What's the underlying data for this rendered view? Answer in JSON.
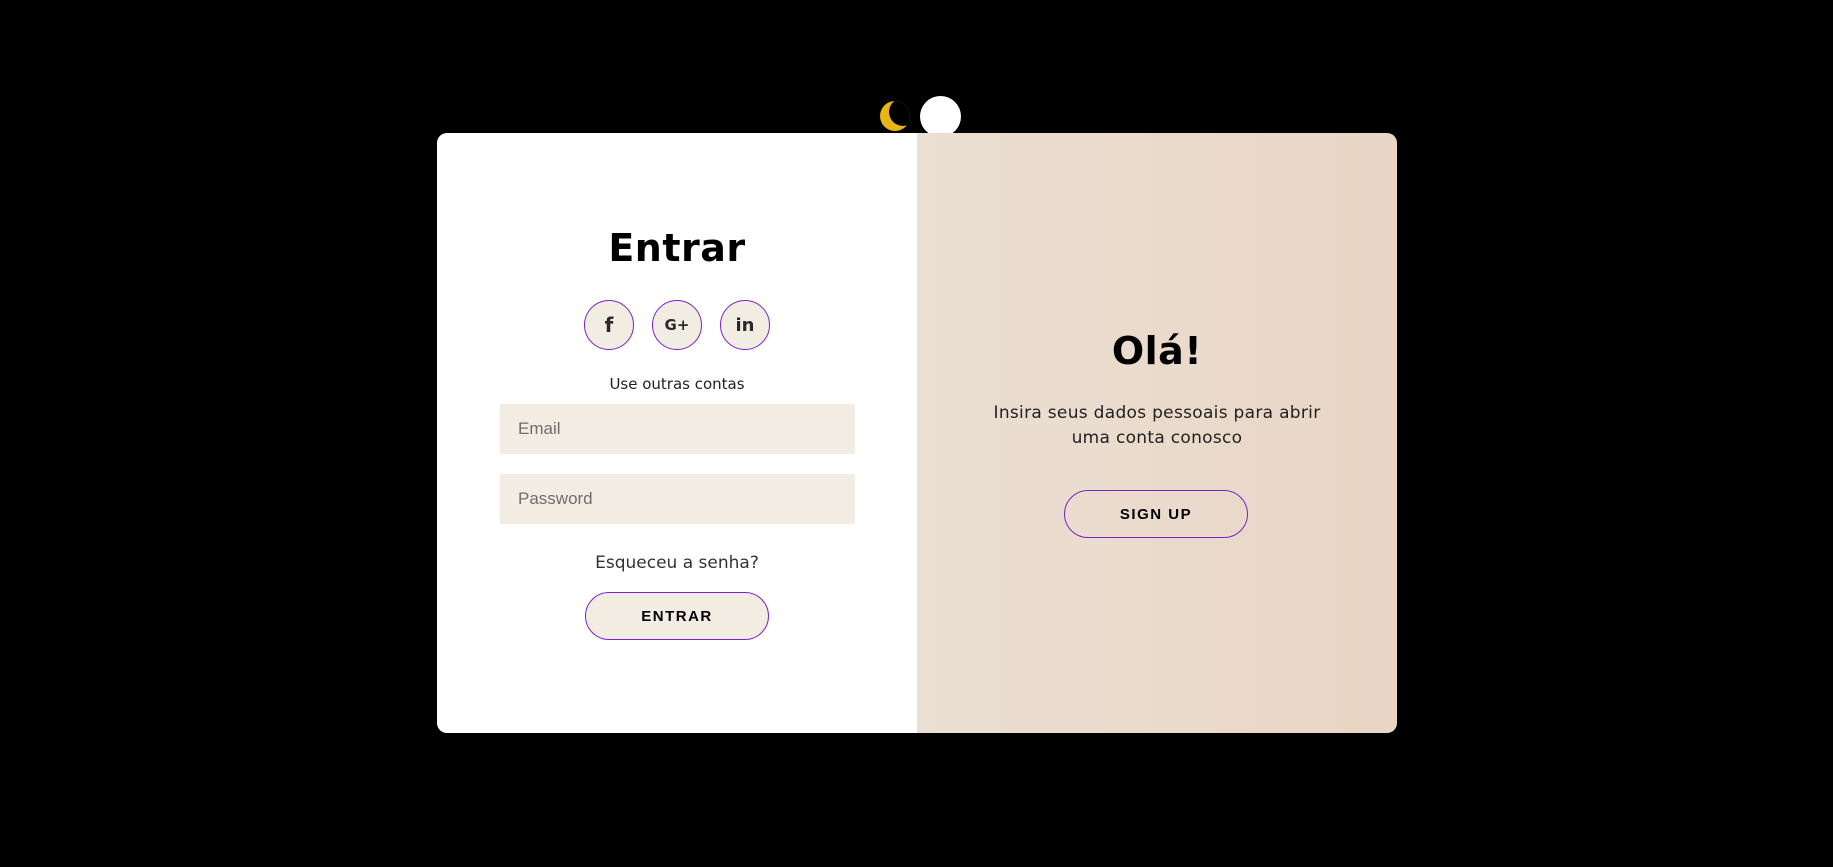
{
  "theme_toggle": {
    "moon_icon": "moon-icon"
  },
  "signin": {
    "title": "Entrar",
    "social": [
      {
        "icon": "facebook-icon",
        "glyph": "f"
      },
      {
        "icon": "google-plus-icon",
        "glyph": "G+"
      },
      {
        "icon": "linkedin-icon",
        "glyph": "in"
      }
    ],
    "use_other_accounts": "Use outras contas",
    "email_placeholder": "Email",
    "password_placeholder": "Password",
    "forgot_password": "Esqueceu a senha?",
    "submit_label": "ENTRAR"
  },
  "signup": {
    "title": "Olá!",
    "text": "Insira seus dados pessoais para abrir uma conta conosco",
    "button_label": "SIGN UP"
  },
  "colors": {
    "background": "#000000",
    "accent_border": "#7b22c7",
    "moon": "#e8b516",
    "input_bg": "#f2ece2",
    "right_panel_start": "#eadfd3",
    "right_panel_end": "#e9d6c5"
  }
}
